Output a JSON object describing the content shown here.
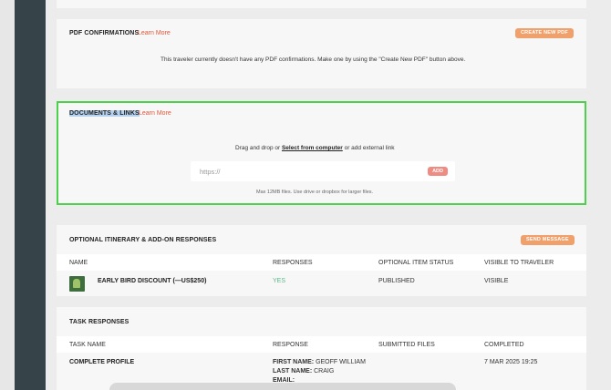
{
  "pdf": {
    "title": "PDF CONFIRMATIONS",
    "learn_more": "Learn More",
    "create_button": "CREATE NEW PDF",
    "empty_message": "This traveler currently doesn't have any PDF confirmations. Make one by using the \"Create New PDF\" button above."
  },
  "documents": {
    "title": "DOCUMENTS & LINKS",
    "learn_more": "Learn More",
    "drop_prefix": "Drag and drop or ",
    "select_link": "Select from computer",
    "drop_suffix": " or add external link",
    "url_placeholder": "https://",
    "add_button": "ADD",
    "hint": "Max 12MB files. Use drive or dropbox for larger files."
  },
  "optional": {
    "title": "OPTIONAL ITINERARY & ADD-ON RESPONSES",
    "send_button": "SEND MESSAGE",
    "columns": [
      "NAME",
      "RESPONSES",
      "OPTIONAL ITEM STATUS",
      "VISIBLE TO TRAVELER"
    ],
    "rows": [
      {
        "name": "EARLY BIRD DISCOUNT (—US$250)",
        "response": "YES",
        "status": "PUBLISHED",
        "visible": "VISIBLE"
      }
    ]
  },
  "tasks": {
    "title": "TASK RESPONSES",
    "columns": [
      "TASK NAME",
      "RESPONSE",
      "SUBMITTED FILES",
      "COMPLETED"
    ],
    "rows": [
      {
        "task": "COMPLETE PROFILE",
        "first_label": "FIRST NAME:",
        "first_value": "GEOFF WILLIAM",
        "last_label": "LAST NAME:",
        "last_value": "CRAIG",
        "email_label": "EMAIL:",
        "completed": "7 MAR 2025 19:25"
      }
    ]
  },
  "colors": {
    "accent": "#f0a06b",
    "link": "#e0593c",
    "rail": "#36444a",
    "focus_border": "#4cd14c",
    "yes": "#5ab88c"
  }
}
